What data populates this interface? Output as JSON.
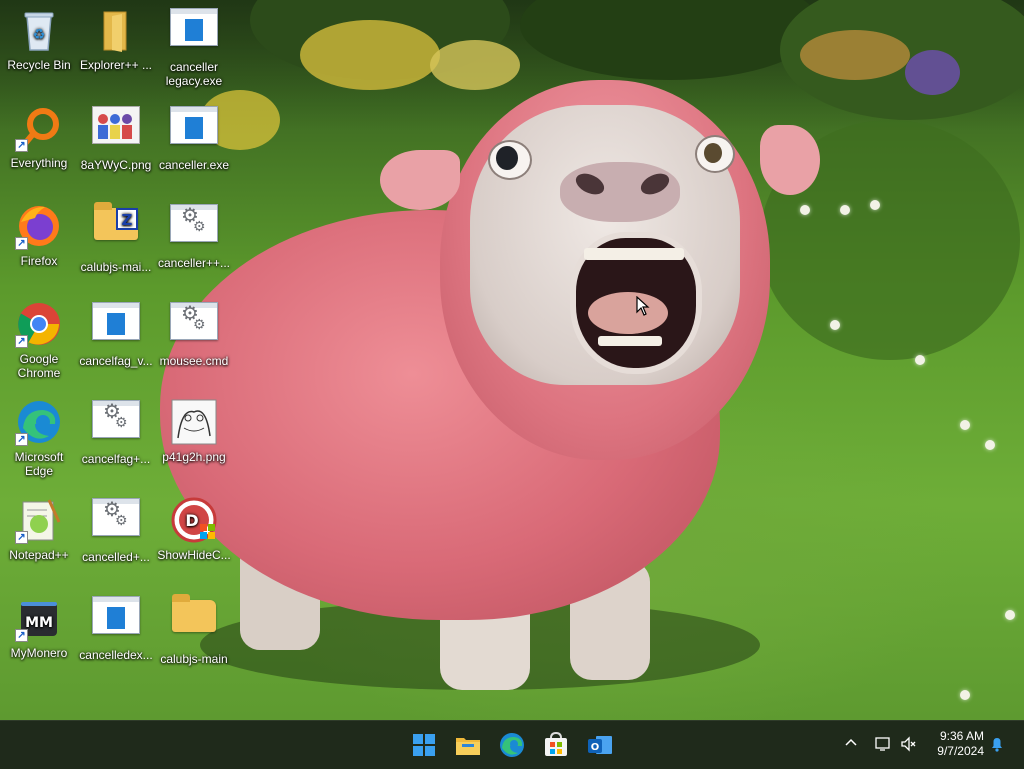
{
  "desktop": {
    "icons": [
      {
        "label": "Recycle Bin"
      },
      {
        "label": "Explorer++ ..."
      },
      {
        "label": "canceller legacy.exe"
      },
      {
        "label": "Everything"
      },
      {
        "label": "8aYWyC.png"
      },
      {
        "label": "canceller.exe"
      },
      {
        "label": "Firefox"
      },
      {
        "label": "calubjs-mai..."
      },
      {
        "label": "canceller++..."
      },
      {
        "label": "Google Chrome"
      },
      {
        "label": "cancelfag_v..."
      },
      {
        "label": "mousee.cmd"
      },
      {
        "label": "Microsoft Edge"
      },
      {
        "label": "cancelfag+..."
      },
      {
        "label": "p41g2h.png"
      },
      {
        "label": "Notepad++"
      },
      {
        "label": "cancelled+..."
      },
      {
        "label": "ShowHideC..."
      },
      {
        "label": "MyMonero"
      },
      {
        "label": "cancelledex..."
      },
      {
        "label": "calubjs-main"
      }
    ]
  },
  "taskbar": {
    "apps": [
      {
        "icon": "windows-start-icon"
      },
      {
        "icon": "file-explorer-icon"
      },
      {
        "icon": "edge-icon"
      },
      {
        "icon": "microsoft-store-icon"
      },
      {
        "icon": "outlook-icon"
      }
    ],
    "tray": {
      "time": "9:36 AM",
      "date": "9/7/2024"
    }
  },
  "colors": {
    "taskbar_bg": "#1f2a1b",
    "accent": "#1f7fd6"
  }
}
